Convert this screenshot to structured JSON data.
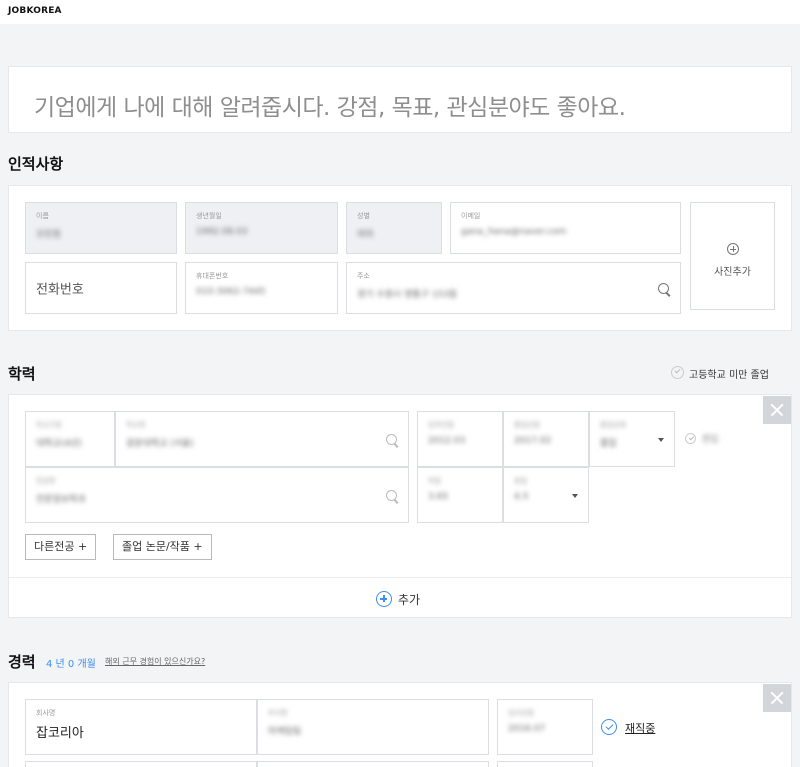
{
  "logo": "JOBKOREA",
  "intro": {
    "placeholder": "기업에게 나에 대해 알려줍시다. 강점, 목표, 관심분야도 좋아요."
  },
  "personal": {
    "title": "인적사항",
    "name": {
      "label": "이름",
      "value": "오민정"
    },
    "birth": {
      "label": "생년월일",
      "value": "1992.08.03"
    },
    "gender": {
      "label": "성별",
      "value": "여자"
    },
    "email": {
      "label": "이메일",
      "value": "gana_hana@naver.com"
    },
    "phone": {
      "placeholder": "전화번호"
    },
    "mobile": {
      "label": "휴대폰번호",
      "value": "010-3062-7445"
    },
    "address": {
      "label": "주소",
      "value": "경기 수원시 영통구 153동"
    },
    "photo": {
      "label": "사진추가"
    }
  },
  "education": {
    "title": "학력",
    "below_high_school": "고등학교 미만 졸업",
    "school_type": {
      "label": "학교구분",
      "value": "대학교(4년)"
    },
    "school_name": {
      "label": "학교명",
      "value": "광운대학교 (서울)"
    },
    "admission": {
      "label": "입학년월",
      "value": "2012.03"
    },
    "graduation": {
      "label": "졸업년월",
      "value": "2017.02"
    },
    "status": {
      "label": "졸업상태",
      "value": "졸업"
    },
    "transfer": "편입",
    "major": {
      "label": "전공명",
      "value": "전문정보학과"
    },
    "gpa": {
      "label": "학점",
      "value": "3.65"
    },
    "gpa_max": {
      "label": "총점",
      "value": "4.5"
    },
    "other_major_btn": "다른전공 +",
    "thesis_btn": "졸업 논문/작품 +",
    "add": "추가"
  },
  "career": {
    "title": "경력",
    "duration": "4 년 0 개월",
    "overseas_link": "해외 근무 경험이 있으신가요?",
    "company": {
      "label": "회사명",
      "value": "잡코리아"
    },
    "department": {
      "label": "부서명",
      "value": "마케팅팀"
    },
    "join_date": {
      "label": "입사년월",
      "value": "2016.07"
    },
    "employed": "재직중"
  }
}
